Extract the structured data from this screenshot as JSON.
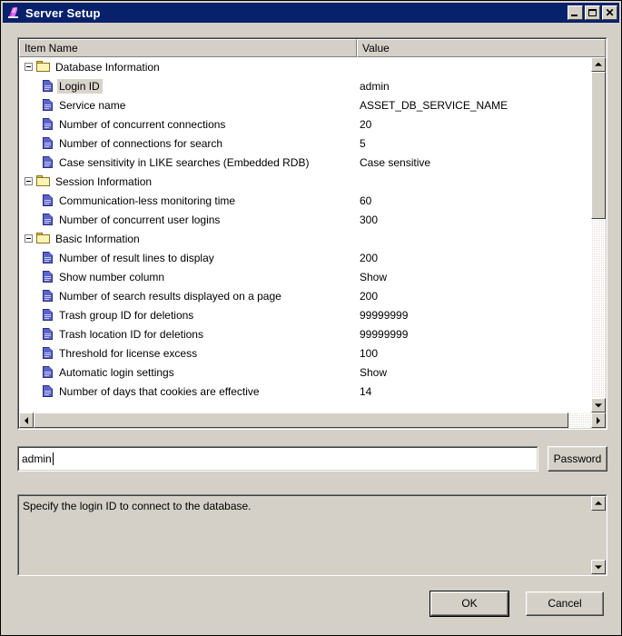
{
  "window": {
    "title": "Server Setup",
    "icon": "app-icon",
    "controls": {
      "minimize": "–",
      "maximize": "□",
      "close": "✕"
    }
  },
  "tree": {
    "columns": {
      "name": "Item Name",
      "value": "Value"
    },
    "rows": [
      {
        "type": "group",
        "label": "Database Information",
        "value": "",
        "expanded": true
      },
      {
        "type": "item",
        "label": "Login ID",
        "value": "admin",
        "selected": true
      },
      {
        "type": "item",
        "label": "Service name",
        "value": "ASSET_DB_SERVICE_NAME"
      },
      {
        "type": "item",
        "label": "Number of concurrent connections",
        "value": "20"
      },
      {
        "type": "item",
        "label": "Number of connections for search",
        "value": "5"
      },
      {
        "type": "item",
        "label": "Case sensitivity in LIKE searches (Embedded RDB)",
        "value": "Case sensitive"
      },
      {
        "type": "group",
        "label": "Session Information",
        "value": "",
        "expanded": true
      },
      {
        "type": "item",
        "label": "Communication-less monitoring time",
        "value": "60"
      },
      {
        "type": "item",
        "label": "Number of concurrent user logins",
        "value": "300"
      },
      {
        "type": "group",
        "label": "Basic Information",
        "value": "",
        "expanded": true
      },
      {
        "type": "item",
        "label": "Number of result lines to display",
        "value": "200"
      },
      {
        "type": "item",
        "label": "Show number column",
        "value": "Show"
      },
      {
        "type": "item",
        "label": "Number of search results displayed on a page",
        "value": "200"
      },
      {
        "type": "item",
        "label": "Trash group ID for deletions",
        "value": "99999999"
      },
      {
        "type": "item",
        "label": "Trash location ID for deletions",
        "value": "99999999"
      },
      {
        "type": "item",
        "label": "Threshold for license excess",
        "value": "100"
      },
      {
        "type": "item",
        "label": "Automatic login settings",
        "value": "Show"
      },
      {
        "type": "item",
        "label": "Number of days that cookies are effective",
        "value": "14"
      }
    ],
    "scroll": {
      "vertical_thumb_percent": 45,
      "horizontal_thumb_percent": 96
    }
  },
  "editor": {
    "value": "admin",
    "password_button": "Password"
  },
  "description": {
    "text": "Specify the login ID to connect to the database."
  },
  "footer": {
    "ok": "OK",
    "cancel": "Cancel"
  },
  "colors": {
    "titlebar": "#08216b",
    "face": "#d4d0c8",
    "field": "#ffffff",
    "selection": "#d8d4cc"
  }
}
